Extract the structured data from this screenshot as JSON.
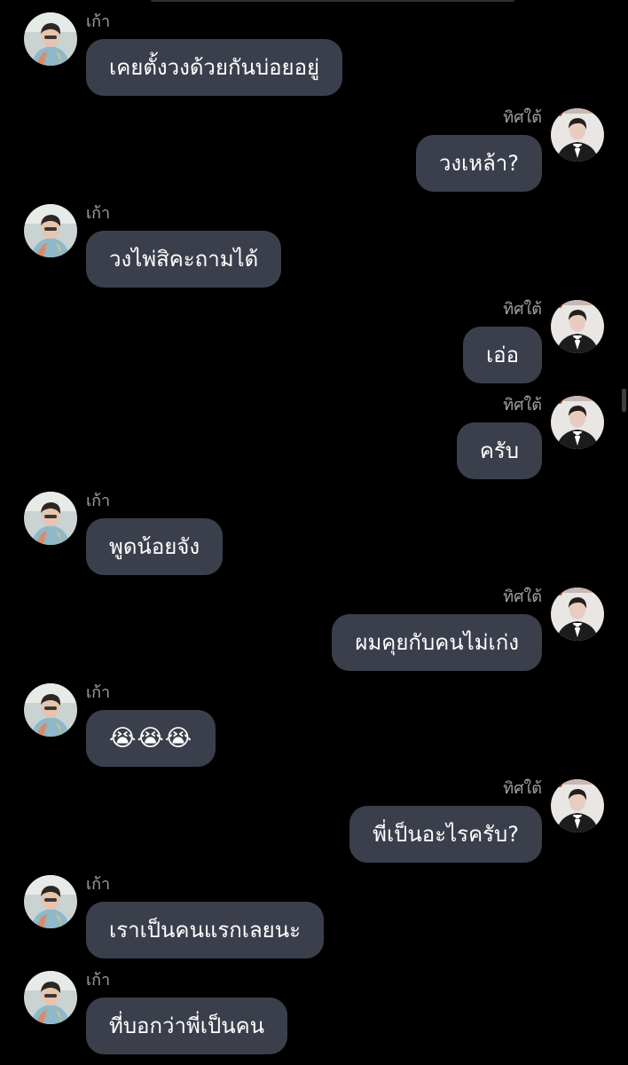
{
  "chat": {
    "left_sender": "เก้า",
    "right_sender": "ทิศใต้",
    "messages": [
      {
        "side": "left",
        "sender": "เก้า",
        "text": "เคยตั้งวงด้วยกันบ่อยอยู่"
      },
      {
        "side": "right",
        "sender": "ทิศใต้",
        "text": "วงเหล้า?"
      },
      {
        "side": "left",
        "sender": "เก้า",
        "text": "วงไพ่สิคะถามได้"
      },
      {
        "side": "right",
        "sender": "ทิศใต้",
        "text": "เอ่อ"
      },
      {
        "side": "right",
        "sender": "ทิศใต้",
        "text": "ครับ"
      },
      {
        "side": "left",
        "sender": "เก้า",
        "text": "พูดน้อยจัง"
      },
      {
        "side": "right",
        "sender": "ทิศใต้",
        "text": "ผมคุยกับคนไม่เก่ง"
      },
      {
        "side": "left",
        "sender": "เก้า",
        "text": "😭😭😭"
      },
      {
        "side": "right",
        "sender": "ทิศใต้",
        "text": "พี่เป็นอะไรครับ?"
      },
      {
        "side": "left",
        "sender": "เก้า",
        "text": "เราเป็นคนแรกเลยนะ"
      },
      {
        "side": "left",
        "sender": "เก้า",
        "text": "ที่บอกว่าพี่เป็นคน"
      }
    ]
  },
  "colors": {
    "background": "#000000",
    "bubble": "#3a3f4b",
    "text": "#ffffff",
    "sender_name": "#9ea1a7"
  },
  "icons": {
    "left_avatar": "avatar-photo-boy-in-floral-shirt",
    "right_avatar": "avatar-photo-man-in-tuxedo"
  }
}
